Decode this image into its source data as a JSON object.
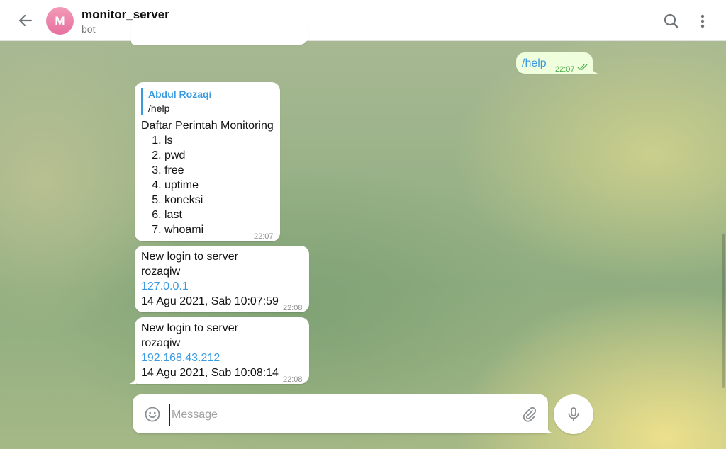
{
  "header": {
    "avatar_letter": "M",
    "title": "monitor_server",
    "subtitle": "bot"
  },
  "messages": {
    "outgoing_help": {
      "text": "/help",
      "time": "22:07"
    },
    "help_reply": {
      "reply_name": "Abdul Rozaqi",
      "reply_text": "/help",
      "heading": "Daftar Perintah Monitoring",
      "commands": [
        "ls",
        "pwd",
        "free",
        "uptime",
        "koneksi",
        "last",
        "whoami"
      ],
      "time": "22:07"
    },
    "login1": {
      "line1": "New login to server",
      "user": "rozaqiw",
      "ip": "127.0.0.1",
      "date": "14 Agu 2021, Sab 10:07:59",
      "time": "22:08"
    },
    "login2": {
      "line1": "New login to server",
      "user": "rozaqiw",
      "ip": "192.168.43.212",
      "date": "14 Agu 2021, Sab 10:08:14",
      "time": "22:08"
    }
  },
  "composer": {
    "placeholder": "Message"
  },
  "colors": {
    "link": "#3a9ae0",
    "outgoing_bubble": "#effedd",
    "read_check": "#4fae4e",
    "avatar": "#e670a0"
  },
  "icons": {
    "back": "arrow-left-icon",
    "search": "search-icon",
    "menu": "more-vertical-icon",
    "emoji": "smile-icon",
    "attach": "paperclip-icon",
    "mic": "microphone-icon"
  }
}
